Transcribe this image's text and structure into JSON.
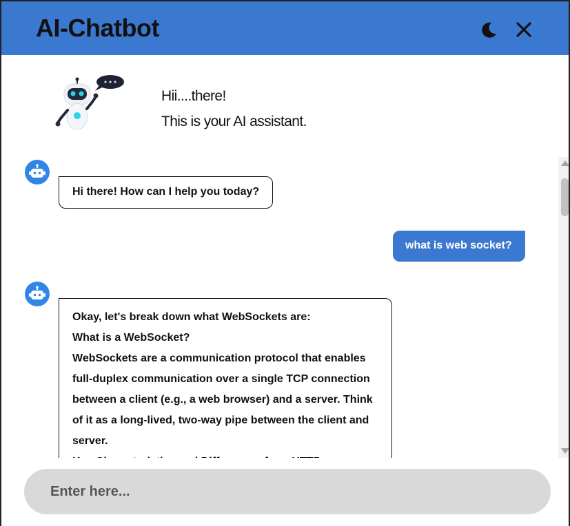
{
  "app": {
    "title": "AI-Chatbot"
  },
  "header": {
    "theme_icon": "moon-icon",
    "close_icon": "close-icon"
  },
  "intro": {
    "line1": "Hii....there!",
    "line2": "This is your AI assistant."
  },
  "messages": [
    {
      "role": "bot",
      "text": "Hi there! How can I help you today?"
    },
    {
      "role": "user",
      "text": "what is web socket?"
    },
    {
      "role": "bot",
      "lines": [
        "Okay, let's break down what WebSockets are:",
        "What is a WebSocket?",
        "WebSockets are a communication protocol that enables full-duplex communication over a single TCP connection between a client (e.g., a web browser) and a server.  Think of it as a long-lived, two-way pipe between the client and server.",
        "Key Characteristics and Differences from HTTP:"
      ]
    }
  ],
  "composer": {
    "placeholder": "Enter here..."
  },
  "colors": {
    "header_bg": "#3b78cf",
    "user_bubble_bg": "#3b78cf",
    "bot_avatar_bg": "#2f86e6",
    "input_bg": "#d9d9d9"
  }
}
